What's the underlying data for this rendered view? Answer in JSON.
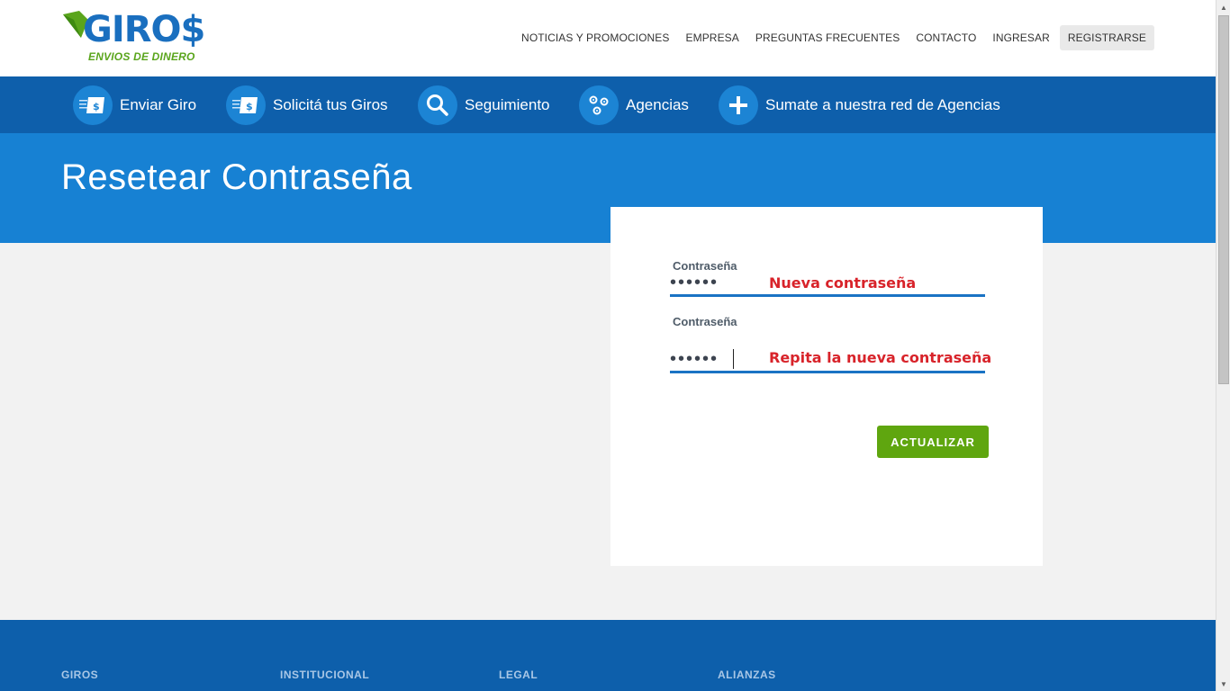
{
  "brand": {
    "name": "GIRO$",
    "tagline": "ENVIOS DE DINERO",
    "colors": {
      "primary_blue": "#1a6fbf",
      "green": "#5aa51c"
    }
  },
  "topnav": {
    "items": [
      "NOTICIAS Y PROMOCIONES",
      "EMPRESA",
      "PREGUNTAS FRECUENTES",
      "CONTACTO",
      "INGRESAR",
      "REGISTRARSE"
    ]
  },
  "services": [
    {
      "label": "Enviar Giro",
      "icon": "money-card-icon"
    },
    {
      "label": "Solicitá tus Giros",
      "icon": "money-card-icon"
    },
    {
      "label": "Seguimiento",
      "icon": "search-icon"
    },
    {
      "label": "Agencias",
      "icon": "map-pins-icon"
    },
    {
      "label": "Sumate a nuestra red de Agencias",
      "icon": "plus-icon"
    }
  ],
  "page": {
    "title": "Resetear Contraseña"
  },
  "form": {
    "password_label": "Contraseña",
    "password_value": "••••••",
    "password_hint": "Nueva contraseña",
    "confirm_label": "Contraseña",
    "confirm_value": "••••••",
    "confirm_hint": "Repita la nueva contraseña",
    "submit_label": "ACTUALIZAR"
  },
  "footer": {
    "columns": [
      "GIROS",
      "INSTITUCIONAL",
      "LEGAL",
      "ALIANZAS"
    ]
  }
}
